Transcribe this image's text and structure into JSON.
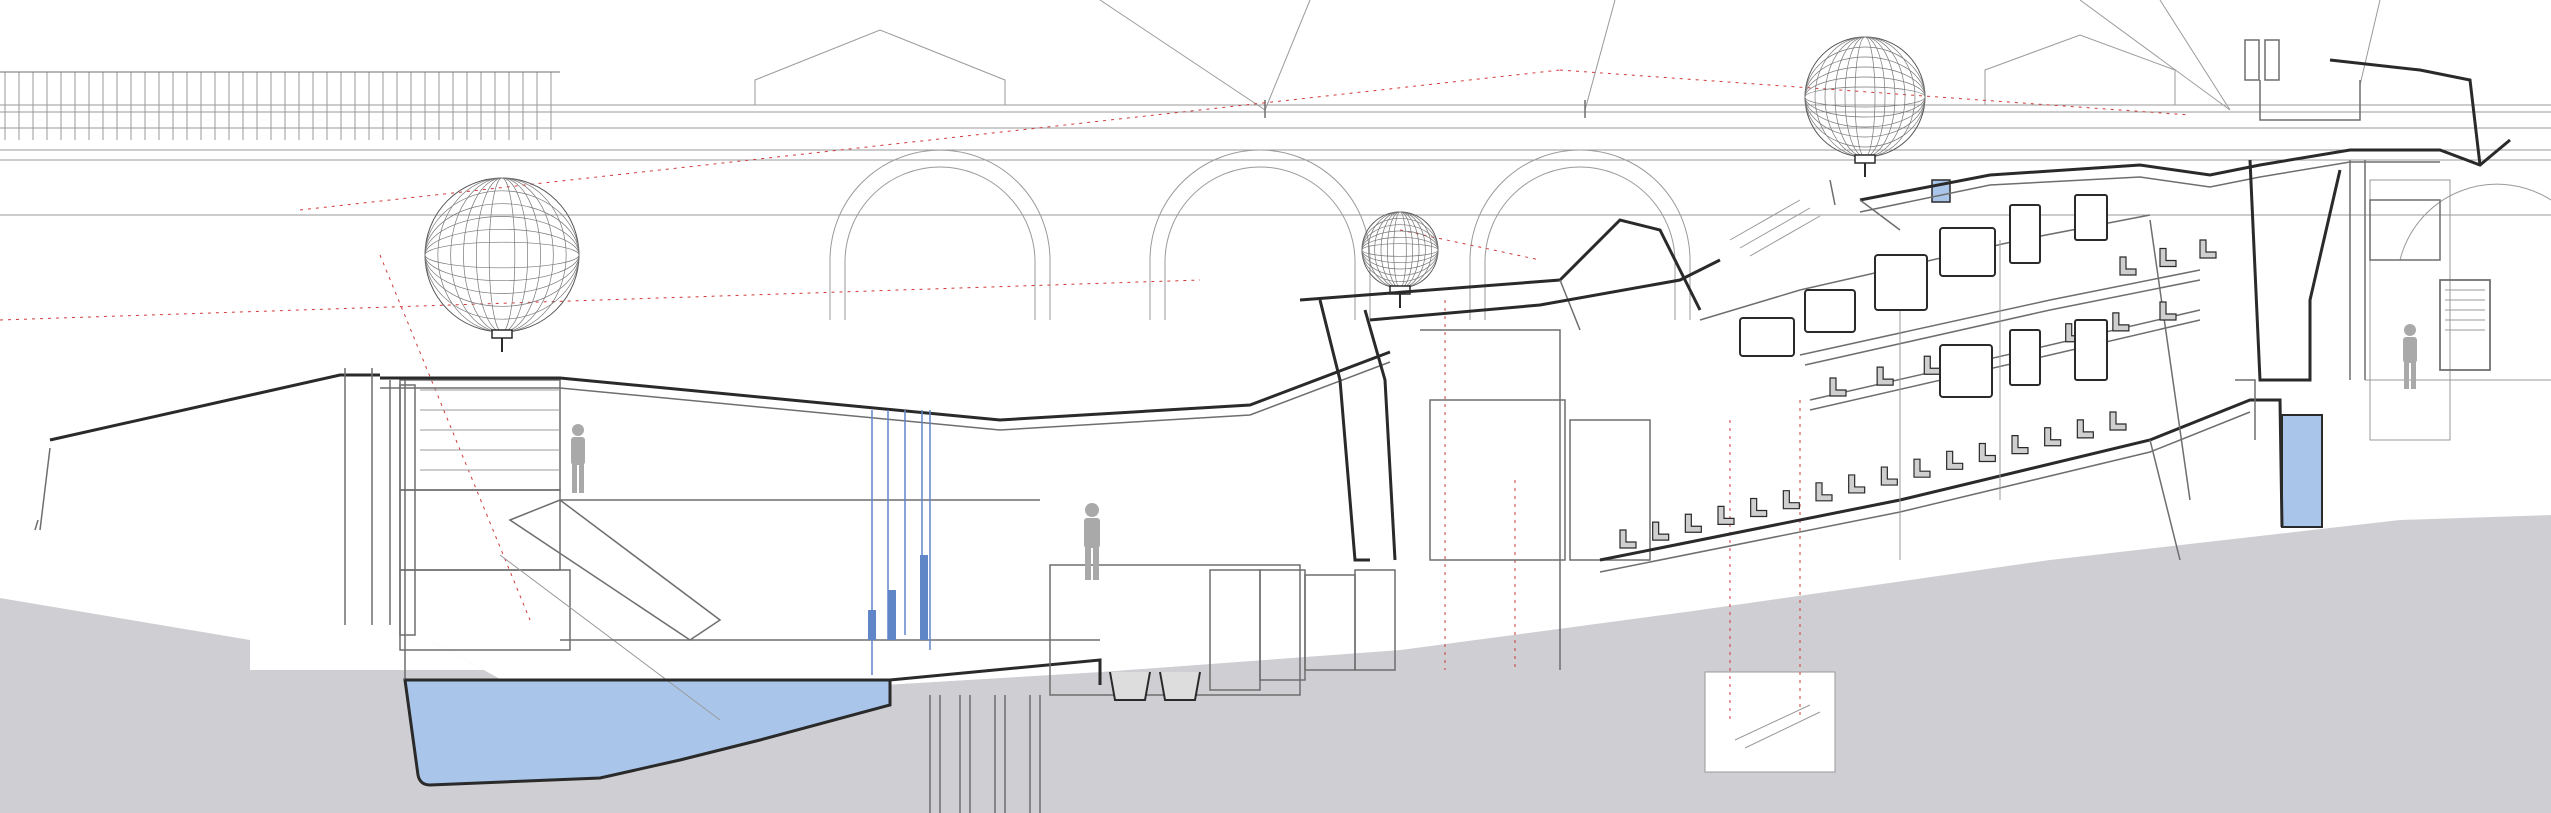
{
  "drawing": {
    "kind": "architectural-section",
    "colors": {
      "background": "#ffffff",
      "ground": "#cfcfd3",
      "water": "#a9c6ea",
      "line": "#2a2a2a",
      "faint_line": "#9a9a9a",
      "red_line": "#d23a3a",
      "blue_line": "#5f86c7"
    }
  }
}
